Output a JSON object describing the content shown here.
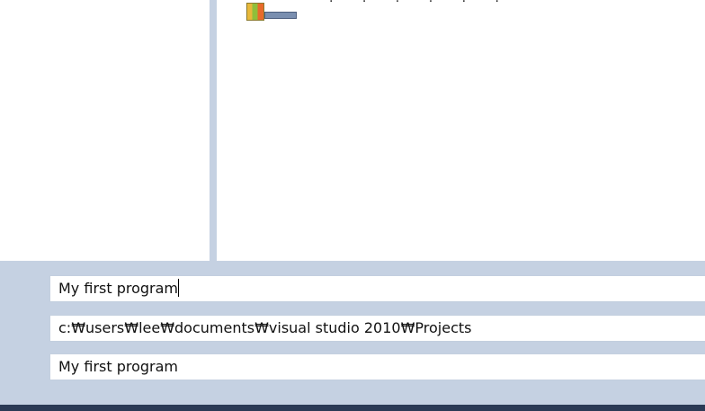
{
  "template_list": {
    "item_label": "· · · · · ·",
    "item_icon": "project-template-icon"
  },
  "form": {
    "name": {
      "value": "My first program"
    },
    "location": {
      "value": "c:₩users₩lee₩documents₩visual studio 2010₩Projects"
    },
    "solution_name": {
      "value": "My first program"
    }
  },
  "colors": {
    "panel_background": "#c5d1e2",
    "field_border": "#c3cfdf",
    "footer": "#2b3a55"
  }
}
